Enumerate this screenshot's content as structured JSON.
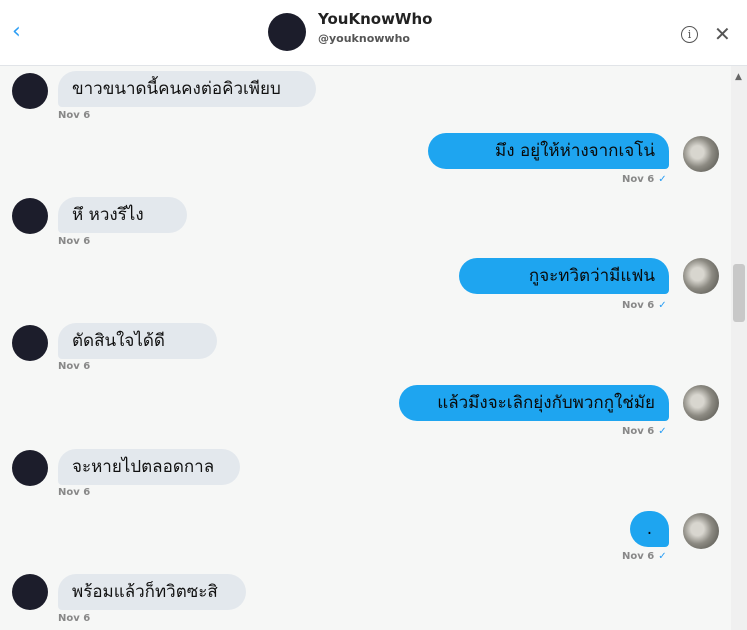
{
  "header": {
    "name": "YouKnowWho",
    "handle": "@youknowwho",
    "back_icon": "chevron-left-icon",
    "info_icon": "info-icon",
    "close_icon": "close-icon"
  },
  "messages": [
    {
      "side": "left",
      "text": "ขาวขนาดนี้คนคงต่อคิวเพียบ",
      "time": "Nov 6"
    },
    {
      "side": "right",
      "text": "มึง อยู่ให้ห่างจากเจโน่",
      "time": "Nov 6"
    },
    {
      "side": "left",
      "text": "หึ หวงรึไง",
      "time": "Nov 6"
    },
    {
      "side": "right",
      "text": "กูจะทวิตว่ามีแฟน",
      "time": "Nov 6"
    },
    {
      "side": "left",
      "text": "ตัดสินใจได้ดี",
      "time": "Nov 6"
    },
    {
      "side": "right",
      "text": "แล้วมึงจะเลิกยุ่งกับพวกกูใช่มัย",
      "time": "Nov 6"
    },
    {
      "side": "left",
      "text": "จะหายไปตลอดกาล",
      "time": "Nov 6"
    },
    {
      "side": "right",
      "text": ".",
      "time": "Nov 6"
    },
    {
      "side": "left",
      "text": "พร้อมแล้วก็ทวิตซะสิ",
      "time": "Nov 6"
    }
  ],
  "colors": {
    "sent_bubble": "#1ea5f0",
    "received_bubble": "#e3e8ed",
    "accent": "#2a9df4"
  }
}
